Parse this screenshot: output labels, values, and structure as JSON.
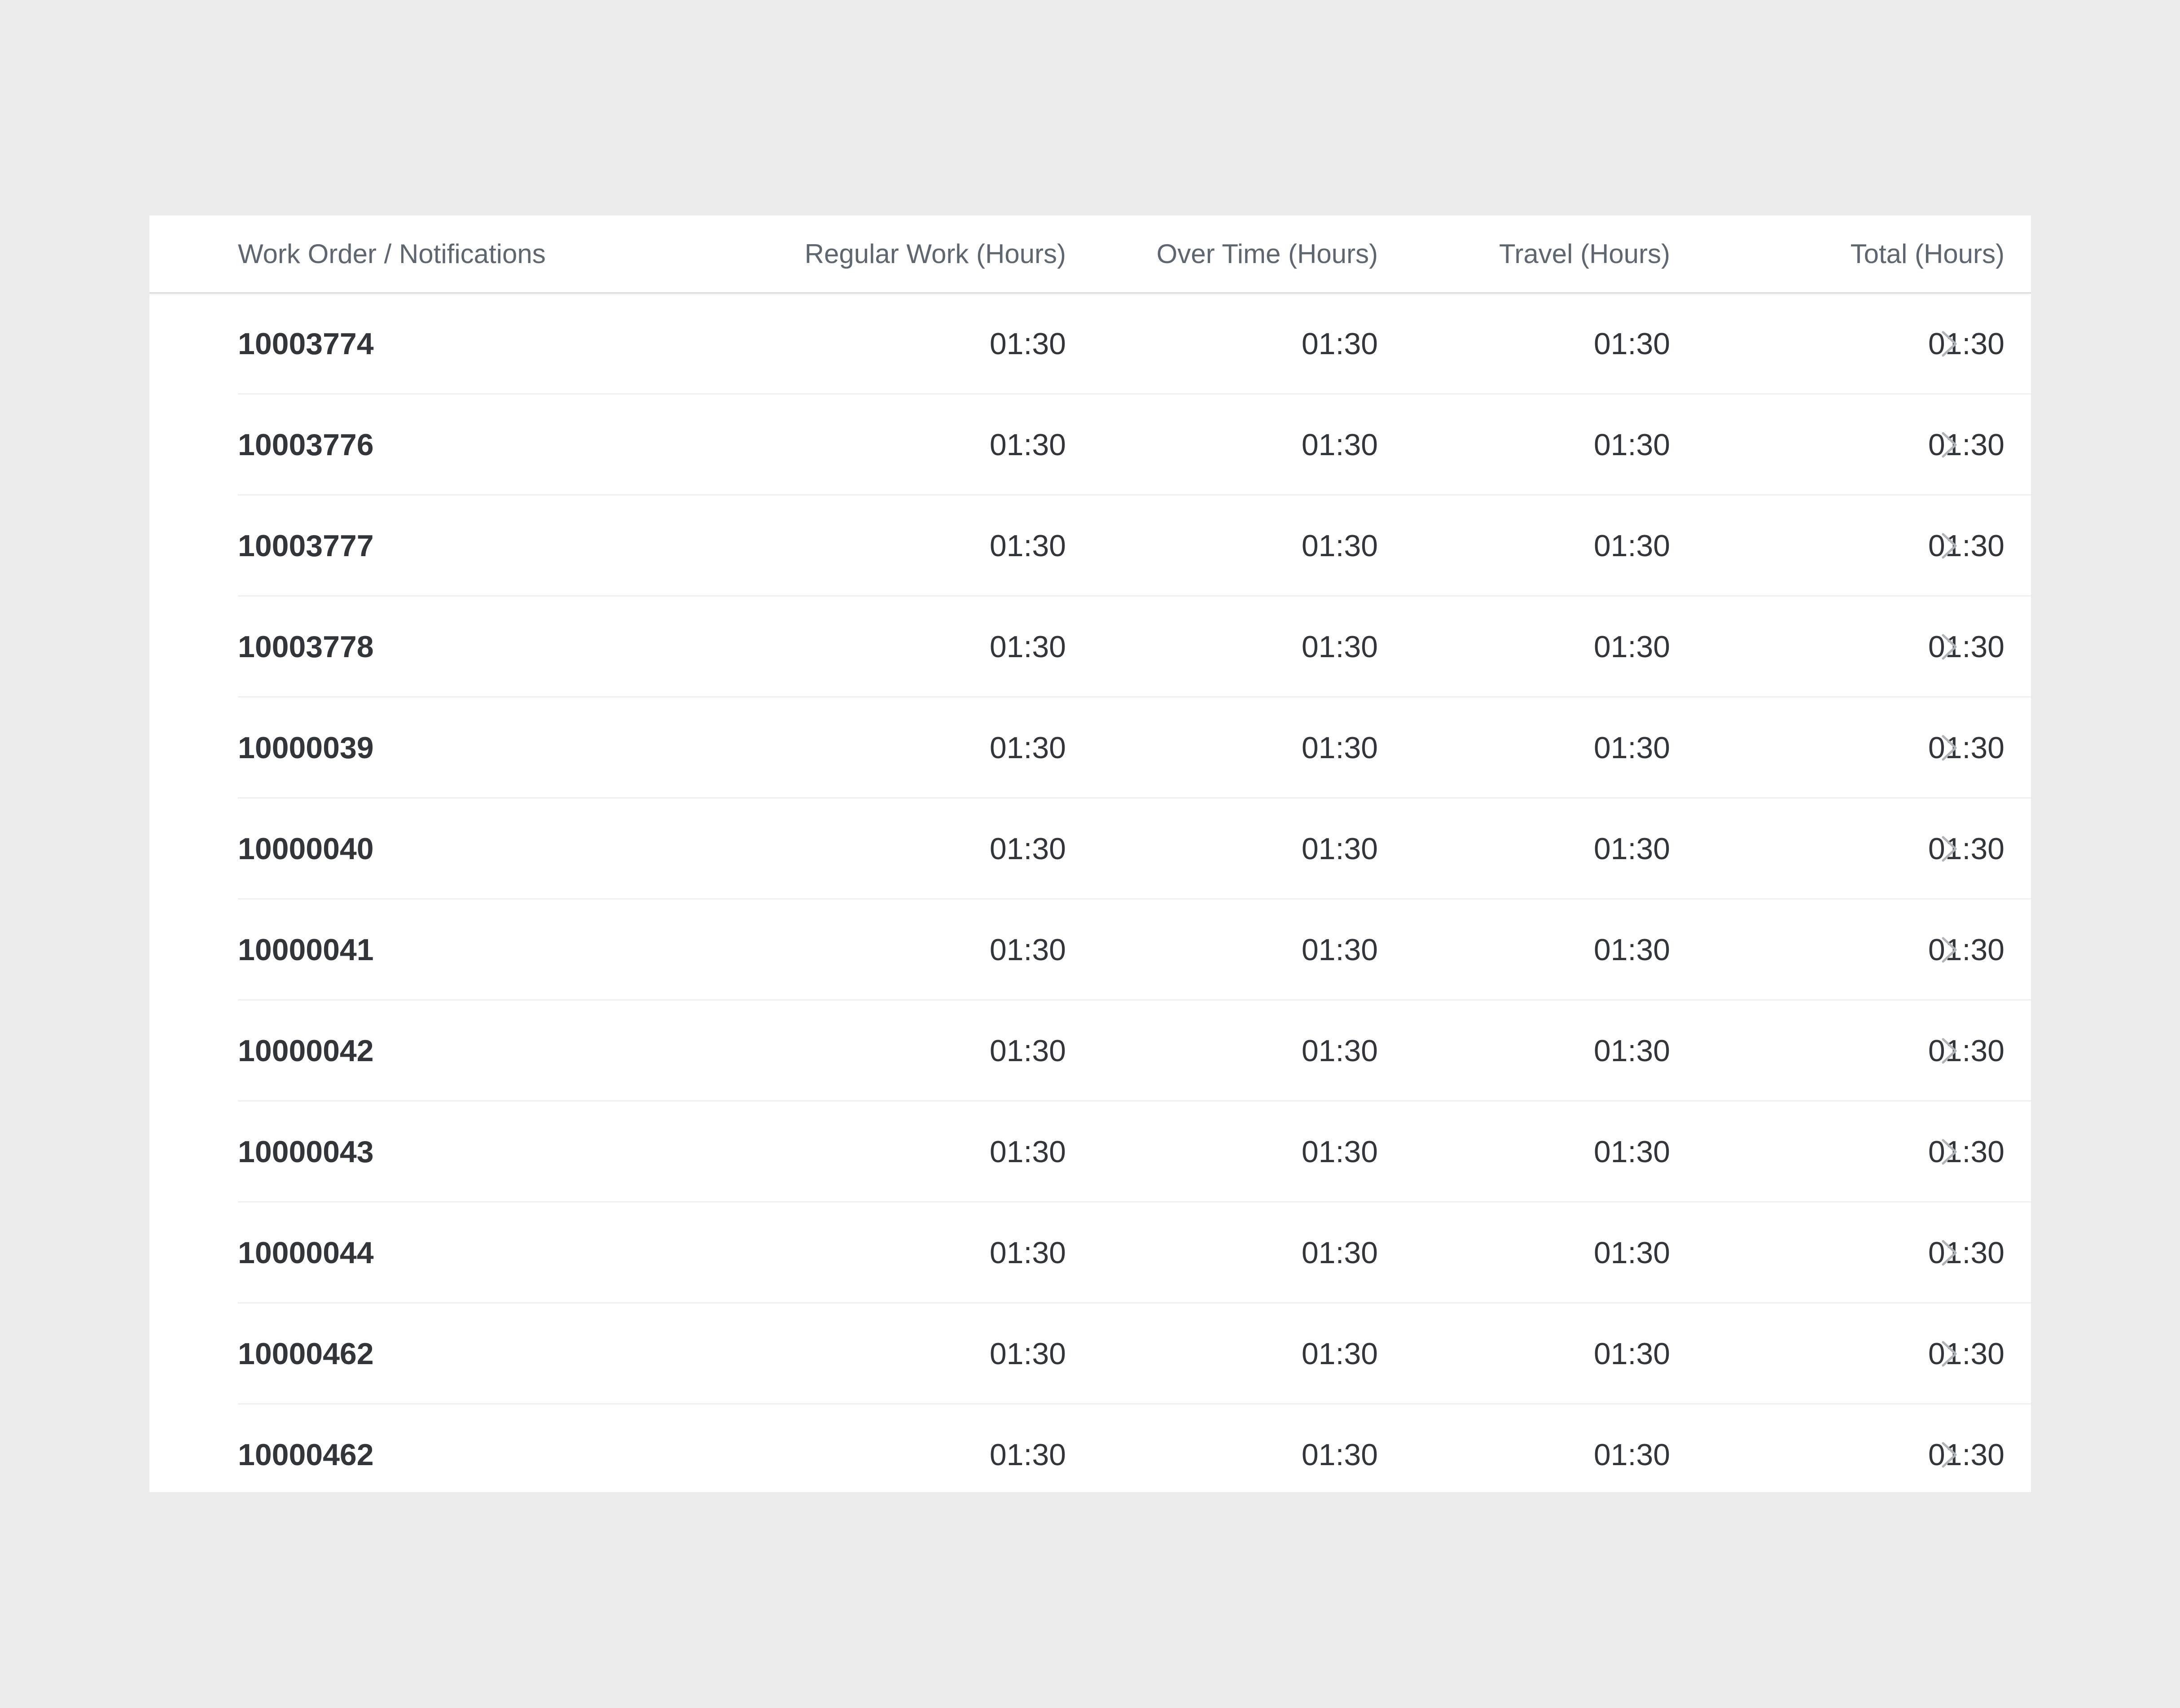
{
  "table": {
    "headers": {
      "work_order": "Work Order / Notifications",
      "regular": "Regular Work (Hours)",
      "overtime": "Over Time (Hours)",
      "travel": "Travel (Hours)",
      "total": "Total (Hours)"
    },
    "rows": [
      {
        "id": "10003774",
        "regular": "01:30",
        "overtime": "01:30",
        "travel": "01:30",
        "total": "01:30"
      },
      {
        "id": "10003776",
        "regular": "01:30",
        "overtime": "01:30",
        "travel": "01:30",
        "total": "01:30"
      },
      {
        "id": "10003777",
        "regular": "01:30",
        "overtime": "01:30",
        "travel": "01:30",
        "total": "01:30"
      },
      {
        "id": "10003778",
        "regular": "01:30",
        "overtime": "01:30",
        "travel": "01:30",
        "total": "01:30"
      },
      {
        "id": "10000039",
        "regular": "01:30",
        "overtime": "01:30",
        "travel": "01:30",
        "total": "01:30"
      },
      {
        "id": "10000040",
        "regular": "01:30",
        "overtime": "01:30",
        "travel": "01:30",
        "total": "01:30"
      },
      {
        "id": "10000041",
        "regular": "01:30",
        "overtime": "01:30",
        "travel": "01:30",
        "total": "01:30"
      },
      {
        "id": "10000042",
        "regular": "01:30",
        "overtime": "01:30",
        "travel": "01:30",
        "total": "01:30"
      },
      {
        "id": "10000043",
        "regular": "01:30",
        "overtime": "01:30",
        "travel": "01:30",
        "total": "01:30"
      },
      {
        "id": "10000044",
        "regular": "01:30",
        "overtime": "01:30",
        "travel": "01:30",
        "total": "01:30"
      },
      {
        "id": "10000462",
        "regular": "01:30",
        "overtime": "01:30",
        "travel": "01:30",
        "total": "01:30"
      },
      {
        "id": "10000462",
        "regular": "01:30",
        "overtime": "01:30",
        "travel": "01:30",
        "total": "01:30"
      }
    ]
  },
  "icons": {
    "row_action": "chevron-right-icon"
  },
  "colors": {
    "background": "#ebebeb",
    "card": "#ffffff",
    "header_text": "#5e6670",
    "body_text": "#32363a",
    "chevron": "#b0b4b8"
  }
}
